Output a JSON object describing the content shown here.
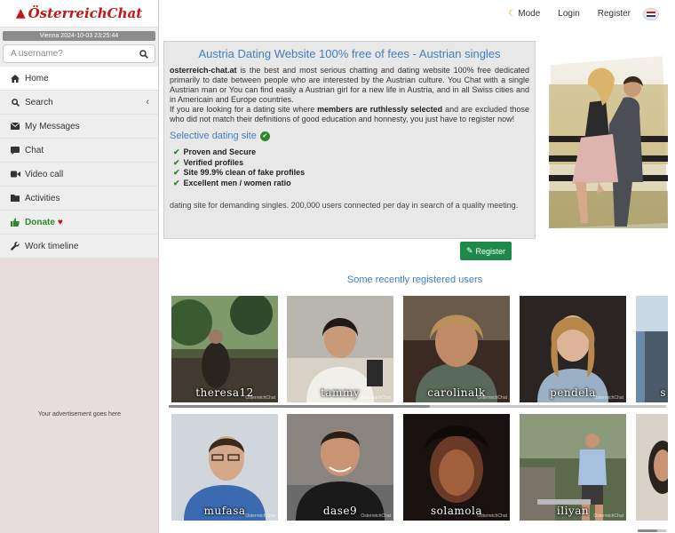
{
  "sidebar": {
    "logo_text": "ÖsterreichChat",
    "datetime": "Vienna 2024-10-03 23:25:44",
    "search_placeholder": "A username?",
    "items": [
      {
        "label": "Home",
        "icon": "home-icon"
      },
      {
        "label": "Search",
        "icon": "search-icon"
      },
      {
        "label": "My Messages",
        "icon": "envelope-icon"
      },
      {
        "label": "Chat",
        "icon": "chat-icon"
      },
      {
        "label": "Video call",
        "icon": "video-icon"
      },
      {
        "label": "Activities",
        "icon": "folder-icon"
      },
      {
        "label": "Donate",
        "icon": "thumbs-up-icon"
      },
      {
        "label": "Work timeline",
        "icon": "wrench-icon"
      }
    ],
    "ad_text": "Your advertisement goes here"
  },
  "topbar": {
    "mode_label": "Mode",
    "login_label": "Login",
    "register_label": "Register"
  },
  "info": {
    "title": "Austria Dating Website 100% free of fees - Austrian singles",
    "site_name": "osterreich-chat.at",
    "para1_rest": " is the best and most serious chatting and dating website 100% free dedicated primarily to date between people who are interested by the Austrian culture. You Chat with a single Austrian man or You can find easily a Austrian girl for a new life in Austria, and in all Swiss cities and in Americain and Europe countries.",
    "para2_start": "If you are looking for a dating site where ",
    "para2_bold": "members are ruthlessly selected",
    "para2_end": " and are excluded those who did not match their definitions of good education and honnesty, you just have to register now!",
    "selective_title": "Selective dating site",
    "features": [
      "Proven and Secure",
      "Verified profiles",
      "Site 99.9% clean of fake profiles",
      "Excellent men / women ratio"
    ],
    "tagline": "dating site for demanding singles. 200,000 users connected per day in search of a quality meeting.",
    "register_button": "Register"
  },
  "recent": {
    "title": "Some recently registered users",
    "watermark": "OsterreichChat",
    "row1": [
      "theresa12",
      "tammy",
      "carolinalk",
      "pendela",
      "s"
    ],
    "row2": [
      "mufasa",
      "dase9",
      "solamola",
      "iliyan",
      ""
    ]
  },
  "colors": {
    "accent_blue": "#3f7fbf",
    "brand_red": "#c01818",
    "register_green": "#1e8a4a",
    "sidebar_bg": "#e9dcdc"
  }
}
